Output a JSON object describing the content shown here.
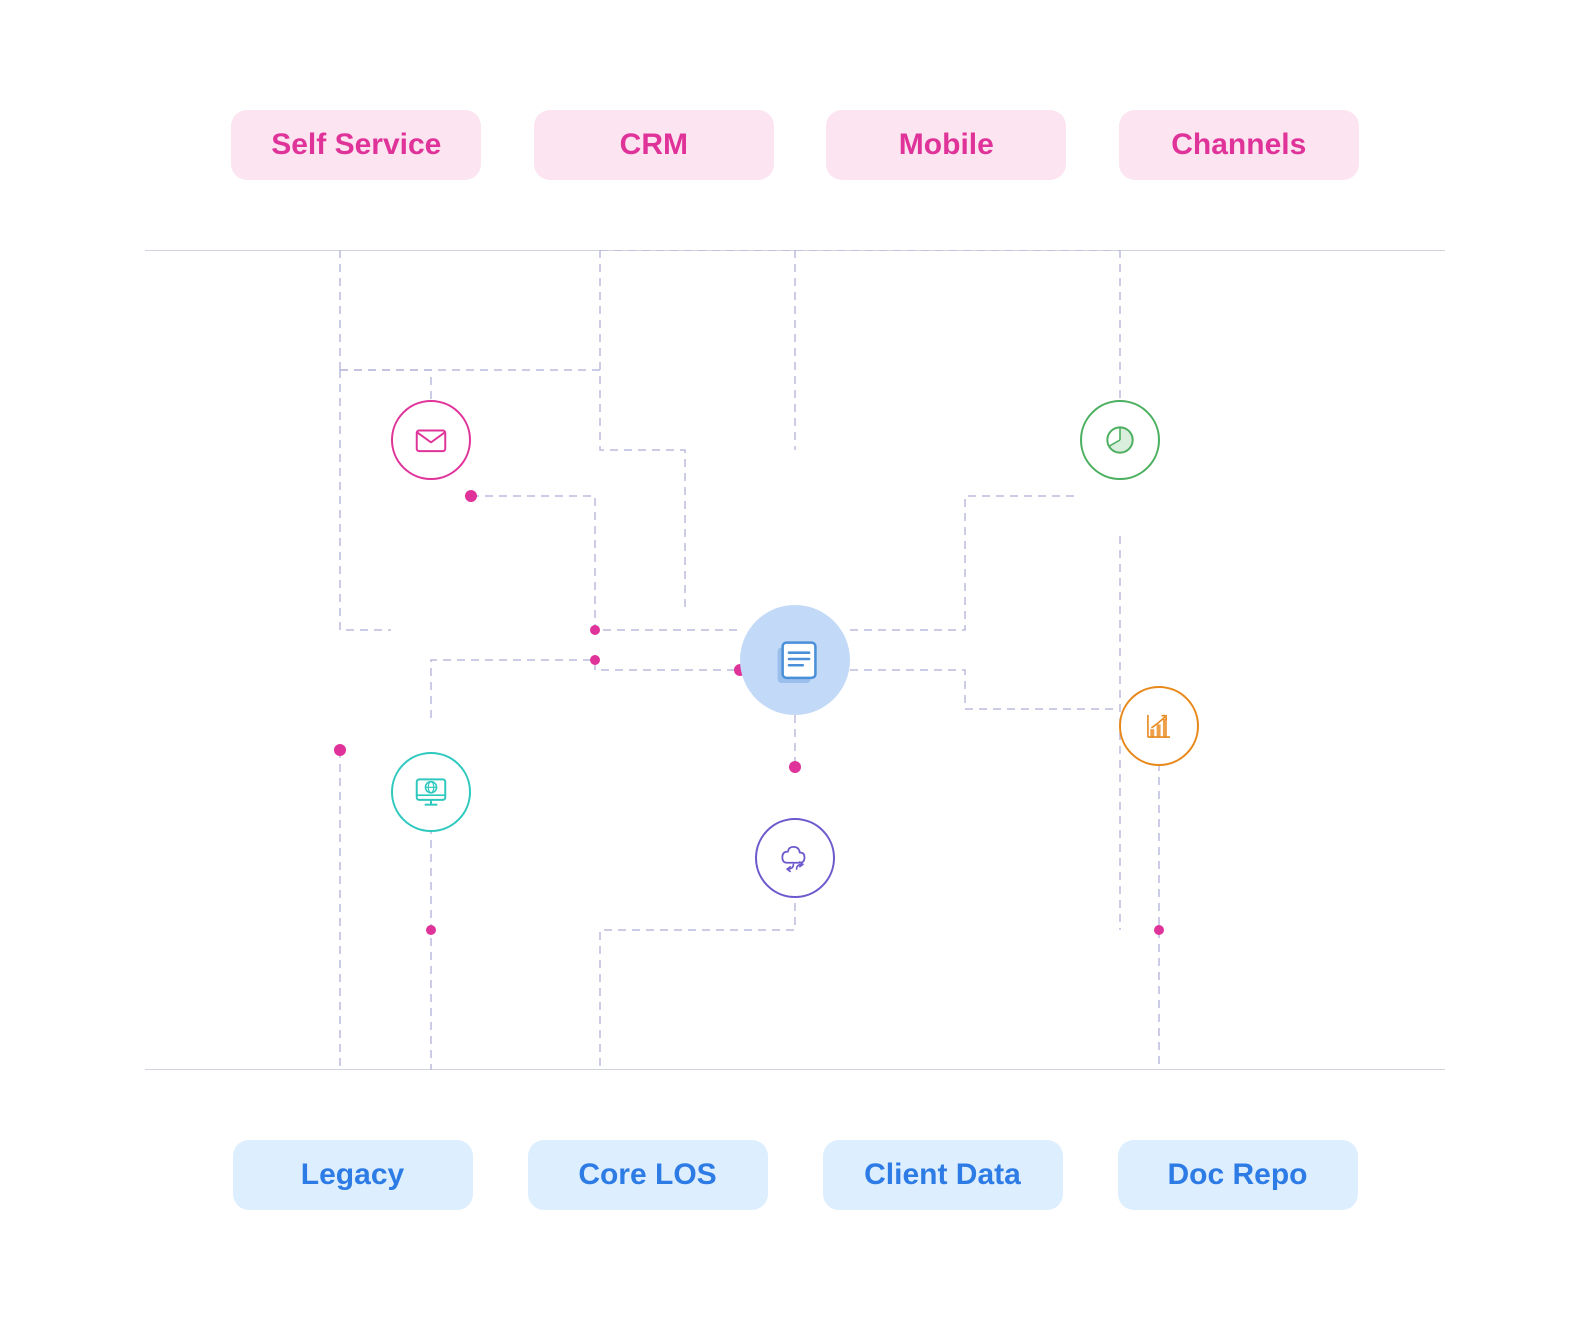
{
  "top_labels": [
    {
      "id": "self-service",
      "text": "Self Service",
      "theme": "pink"
    },
    {
      "id": "crm",
      "text": "CRM",
      "theme": "pink"
    },
    {
      "id": "mobile",
      "text": "Mobile",
      "theme": "pink"
    },
    {
      "id": "channels",
      "text": "Channels",
      "theme": "pink"
    }
  ],
  "bottom_labels": [
    {
      "id": "legacy",
      "text": "Legacy",
      "theme": "blue"
    },
    {
      "id": "core-los",
      "text": "Core LOS",
      "theme": "blue"
    },
    {
      "id": "client-data",
      "text": "Client Data",
      "theme": "blue"
    },
    {
      "id": "doc-repo",
      "text": "Doc Repo",
      "theme": "blue"
    }
  ],
  "icons": {
    "center": "document",
    "email": "envelope",
    "globe": "globe",
    "pie": "pie-chart",
    "bar": "bar-chart",
    "cloud": "cloud-sync"
  },
  "colors": {
    "pink": "#e0339a",
    "pink_bg": "#fce4f0",
    "blue": "#2d7be5",
    "blue_bg": "#ddeeff",
    "teal": "#2ec9be",
    "green": "#4caf60",
    "orange": "#e8881a",
    "purple": "#6a5acd",
    "center_bg": "#c2d9f8",
    "dashed_line": "#aaaacc",
    "separator": "#d0d5dd"
  }
}
